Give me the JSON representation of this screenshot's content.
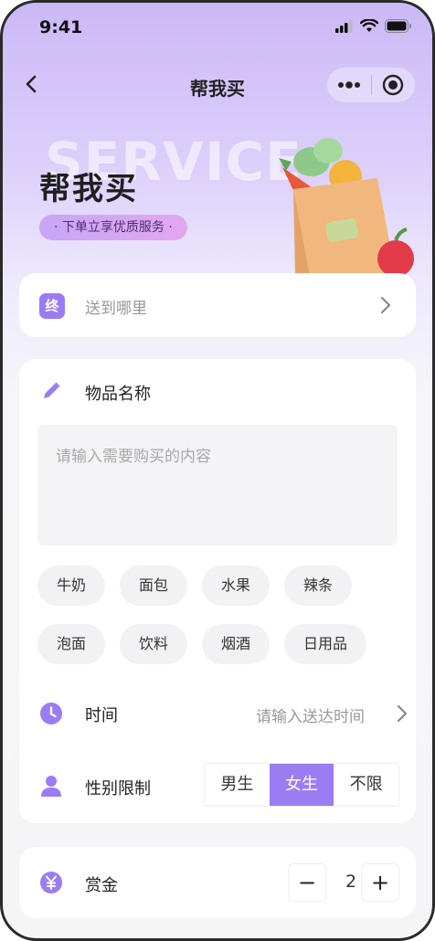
{
  "status_bar": {
    "time": "9:41"
  },
  "nav": {
    "title": "帮我买"
  },
  "hero": {
    "watermark": "SERVICE",
    "title": "帮我买",
    "tagline": "· 下单立享优质服务 ·"
  },
  "address": {
    "tag": "终",
    "placeholder": "送到哪里"
  },
  "item": {
    "label": "物品名称",
    "placeholder": "请输入需要购买的内容",
    "chips": [
      "牛奶",
      "面包",
      "水果",
      "辣条",
      "泡面",
      "饮料",
      "烟酒",
      "日用品"
    ]
  },
  "time_row": {
    "label": "时间",
    "placeholder": "请输入送达时间"
  },
  "gender": {
    "label": "性别限制",
    "options": [
      "男生",
      "女生",
      "不限"
    ],
    "selected": "女生"
  },
  "reward": {
    "label": "赏金",
    "value": "2",
    "minus": "−",
    "plus": "+"
  },
  "colors": {
    "accent": "#9b7df3",
    "chip_bg": "#f2f2f4"
  }
}
